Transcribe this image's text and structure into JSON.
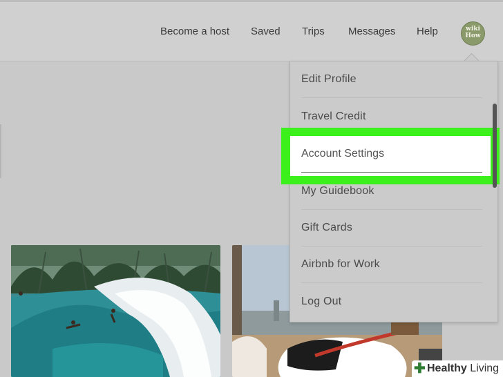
{
  "nav": {
    "become_host": "Become a host",
    "saved": "Saved",
    "trips": "Trips",
    "messages": "Messages",
    "help": "Help",
    "avatar_line1": "wiki",
    "avatar_line2": "How"
  },
  "dropdown": {
    "items": [
      {
        "label": "Edit Profile"
      },
      {
        "label": "Travel Credit"
      },
      {
        "label": "Account Settings"
      },
      {
        "label": "My Guidebook"
      },
      {
        "label": "Gift Cards"
      },
      {
        "label": "Airbnb for Work"
      },
      {
        "label": "Log Out"
      }
    ],
    "highlighted_index": 2
  },
  "colors": {
    "highlight": "#3cf01b",
    "overlay_dim": "#c9c9c9"
  },
  "watermark": {
    "brand_bold": "Healthy",
    "brand_rest": " Living"
  }
}
